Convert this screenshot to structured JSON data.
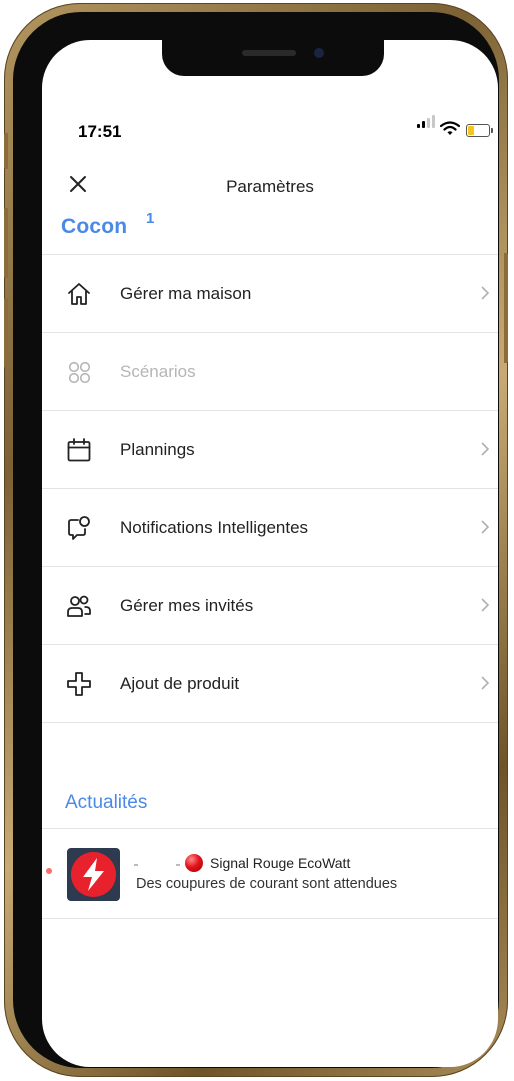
{
  "status_bar": {
    "time": "17:51"
  },
  "header": {
    "title": "Paramètres",
    "brand": "Cocon",
    "brand_mark": "1"
  },
  "menu": [
    {
      "label": "Gérer ma maison",
      "icon": "home-icon",
      "enabled": true
    },
    {
      "label": "Scénarios",
      "icon": "scenarios-icon",
      "enabled": false
    },
    {
      "label": "Plannings",
      "icon": "calendar-icon",
      "enabled": true
    },
    {
      "label": "Notifications Intelligentes",
      "icon": "smart-notification-icon",
      "enabled": true
    },
    {
      "label": "Gérer mes invités",
      "icon": "users-icon",
      "enabled": true
    },
    {
      "label": "Ajout de produit",
      "icon": "add-product-icon",
      "enabled": true
    }
  ],
  "news_section": {
    "title": "Actualités",
    "items": [
      {
        "title": "Signal Rouge EcoWatt",
        "subtitle": "Des coupures de courant sont attendues",
        "icon": "ecowatt-bolt-icon"
      }
    ]
  },
  "colors": {
    "accent": "#4a89e8",
    "alert": "#e8222c",
    "battery": "#f5c518"
  }
}
